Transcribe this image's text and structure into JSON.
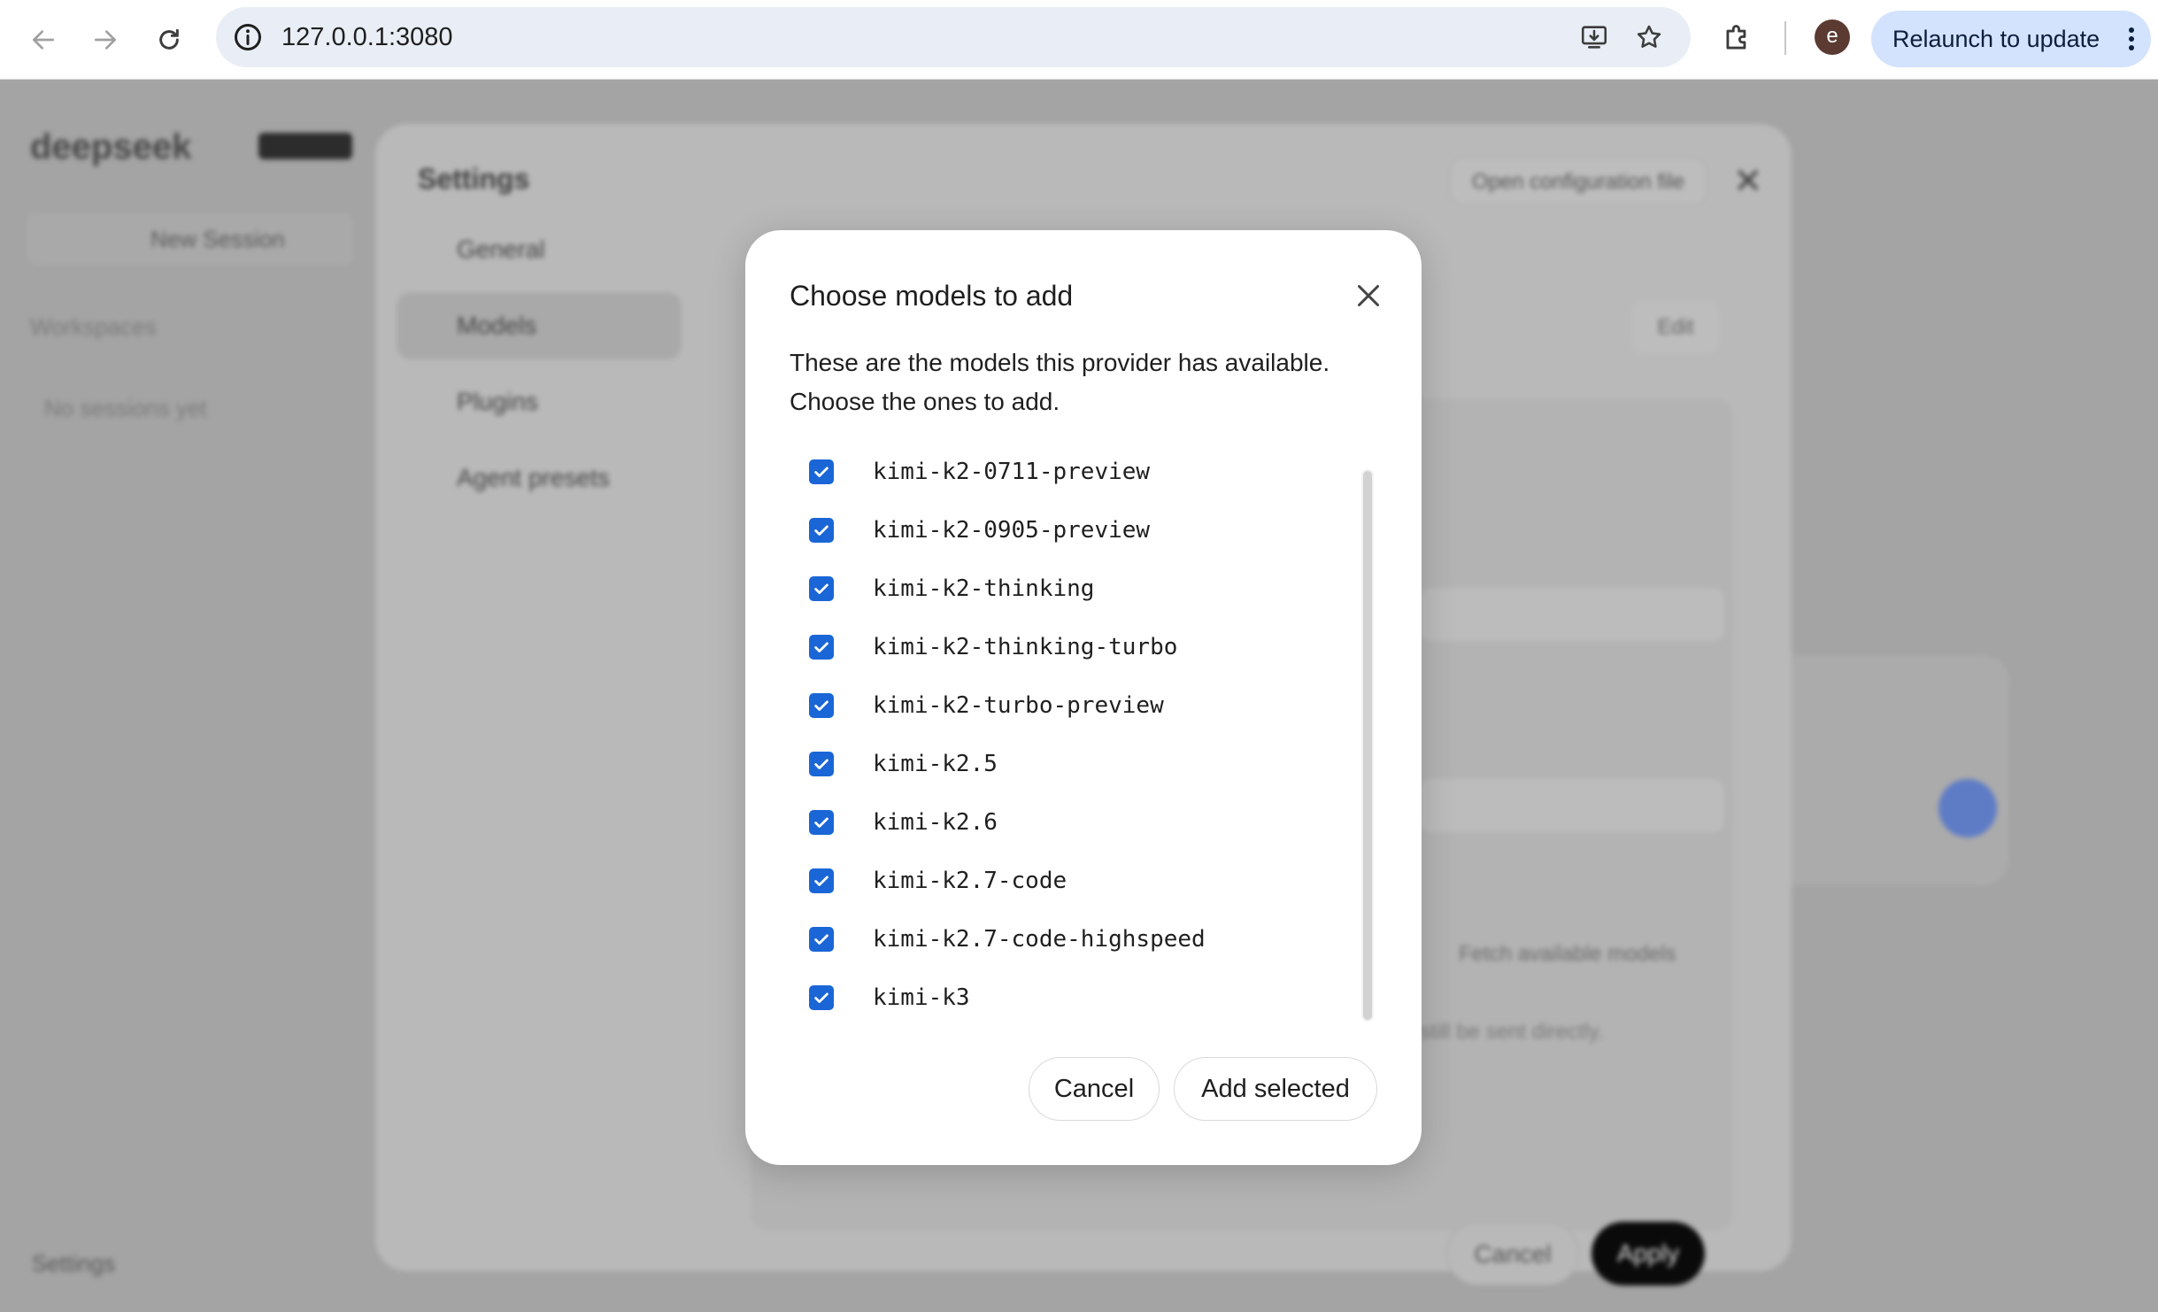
{
  "browser": {
    "url": "127.0.0.1:3080",
    "profile_initial": "e",
    "relaunch_label": "Relaunch to update"
  },
  "app": {
    "logo": "deepseek",
    "new_session": "New Session",
    "workspaces": "Workspaces",
    "no_sessions": "No sessions yet",
    "settings_link": "Settings"
  },
  "settings": {
    "title": "Settings",
    "open_config": "Open configuration file",
    "nav": [
      {
        "label": "General",
        "icon": "gear-icon"
      },
      {
        "label": "Models",
        "icon": "models-icon"
      },
      {
        "label": "Plugins",
        "icon": "plugins-icon"
      },
      {
        "label": "Agent presets",
        "icon": "agent-icon"
      }
    ],
    "edit": "Edit",
    "fetch_models": "Fetch available models",
    "note": "still be sent directly.",
    "cancel": "Cancel",
    "apply": "Apply"
  },
  "modal": {
    "title": "Choose models to add",
    "description": "These are the models this provider has available. Choose the ones to add.",
    "models": [
      {
        "name": "kimi-k2-0711-preview",
        "checked": true
      },
      {
        "name": "kimi-k2-0905-preview",
        "checked": true
      },
      {
        "name": "kimi-k2-thinking",
        "checked": true
      },
      {
        "name": "kimi-k2-thinking-turbo",
        "checked": true
      },
      {
        "name": "kimi-k2-turbo-preview",
        "checked": true
      },
      {
        "name": "kimi-k2.5",
        "checked": true
      },
      {
        "name": "kimi-k2.6",
        "checked": true
      },
      {
        "name": "kimi-k2.7-code",
        "checked": true
      },
      {
        "name": "kimi-k2.7-code-highspeed",
        "checked": true
      },
      {
        "name": "kimi-k3",
        "checked": true
      }
    ],
    "cancel_label": "Cancel",
    "add_label": "Add selected"
  },
  "colors": {
    "accent": "#1a66d6",
    "relaunch_bg": "#d3e3fd"
  }
}
